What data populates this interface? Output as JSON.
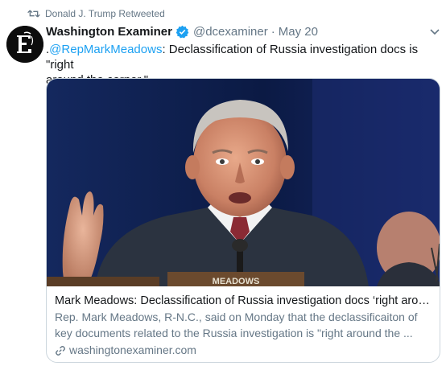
{
  "retweet": {
    "icon": "retweet-icon",
    "text": "Donald J. Trump Retweeted"
  },
  "tweet": {
    "author": {
      "display_name": "Washington Examiner",
      "verified_icon": "verified-badge-icon",
      "handle": "@dcexaminer",
      "separator": "·",
      "date": "May 20",
      "avatar_icon": "washington-examiner-logo"
    },
    "text": {
      "lead": ".",
      "mention": "@RepMarkMeadows",
      "body_line1": ": Declassification of Russia investigation docs is \"right",
      "body_line2": "around the corner.\""
    },
    "card": {
      "title": "Mark Meadows: Declassification of Russia investigation docs ‘right aroun...",
      "description": "Rep. Mark Meadows, R-N.C., said on Monday that the declassificaiton of",
      "description_line2": "key documents related to the Russia investigation is \"right around the ...",
      "link_icon": "link-icon",
      "domain": "washingtonexaminer.com",
      "image_caption_icon": "speaker-photo-nameplate",
      "nameplate_text": "MEADOWS"
    }
  },
  "colors": {
    "link_blue": "#1da1f2",
    "muted_gray": "#657786",
    "text_dark": "#14171a",
    "border": "#ccd6dd"
  }
}
